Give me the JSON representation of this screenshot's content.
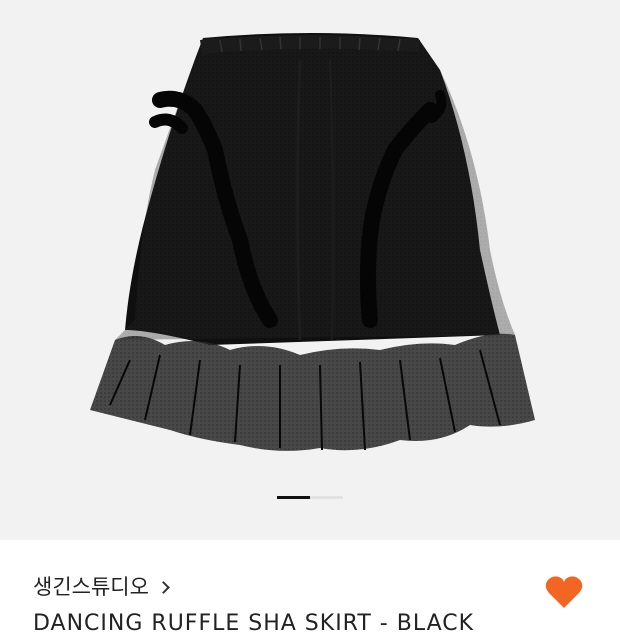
{
  "product": {
    "brand": "생긴스튜디오",
    "name": "DANCING RUFFLE SHA SKIRT - BLACK",
    "image": "black-ruffle-tulle-skirt"
  },
  "gallery": {
    "current_index": 1,
    "total": 2
  },
  "actions": {
    "like_icon": "heart-icon",
    "like_color": "#f26522",
    "liked": true
  },
  "colors": {
    "gallery_bg": "#f2f2f2",
    "accent": "#f26522"
  }
}
